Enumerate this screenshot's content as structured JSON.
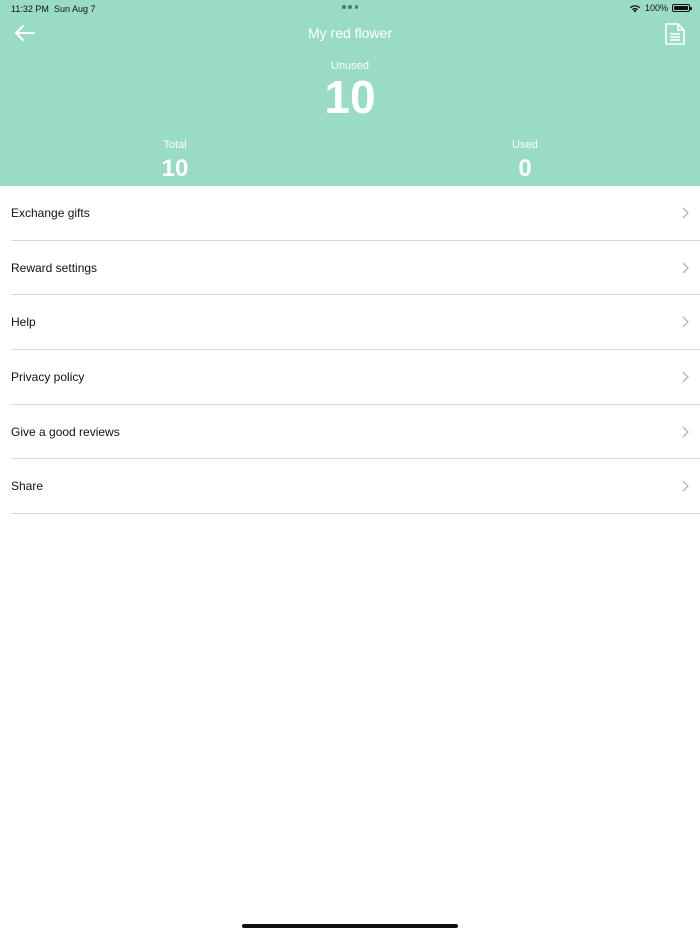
{
  "status_bar": {
    "time": "11:32 PM",
    "date": "Sun Aug 7",
    "battery": "100%"
  },
  "header": {
    "title": "My red flower",
    "unused_label": "Unused",
    "unused_value": "10",
    "total_label": "Total",
    "total_value": "10",
    "used_label": "Used",
    "used_value": "0",
    "background_color": "#9adbc6"
  },
  "menu": {
    "items": [
      {
        "label": "Exchange gifts"
      },
      {
        "label": "Reward settings"
      },
      {
        "label": "Help"
      },
      {
        "label": "Privacy policy"
      },
      {
        "label": "Give a good reviews"
      },
      {
        "label": "Share"
      }
    ]
  },
  "icons": {
    "back": "arrow-left-icon",
    "document": "document-icon",
    "chevron": "chevron-right-icon",
    "wifi": "wifi-icon",
    "battery": "battery-icon"
  }
}
